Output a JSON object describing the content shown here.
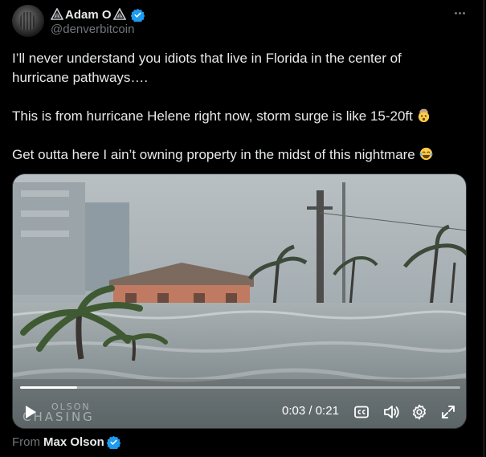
{
  "author": {
    "display_name": "Adam O",
    "handle": "@denverbitcoin",
    "verified_color": "#1d9bf0"
  },
  "tweet": {
    "line1": "I’ll never understand you idiots that live in Florida in the center of hurricane pathways….",
    "line2": "This is from hurricane Helene right now, storm surge is like 15-20ft",
    "line2_emoji": "exploding-head-emoji",
    "line3": "Get outta here I ain’t owning property in the midst of this nightmare",
    "line3_emoji": "tears-of-joy-emoji"
  },
  "video": {
    "current_time": "0:03",
    "separator": "/",
    "duration": "0:21",
    "progress": 0.13,
    "watermark_line1": "OLSON",
    "watermark_line2": "CHASING"
  },
  "attribution": {
    "prefix": "From",
    "name": "Max Olson"
  },
  "icons": {
    "more": "more-horizontal-icon",
    "play": "play-icon",
    "captions": "captions-icon",
    "volume": "volume-icon",
    "settings": "settings-icon",
    "fullscreen": "fullscreen-icon"
  }
}
